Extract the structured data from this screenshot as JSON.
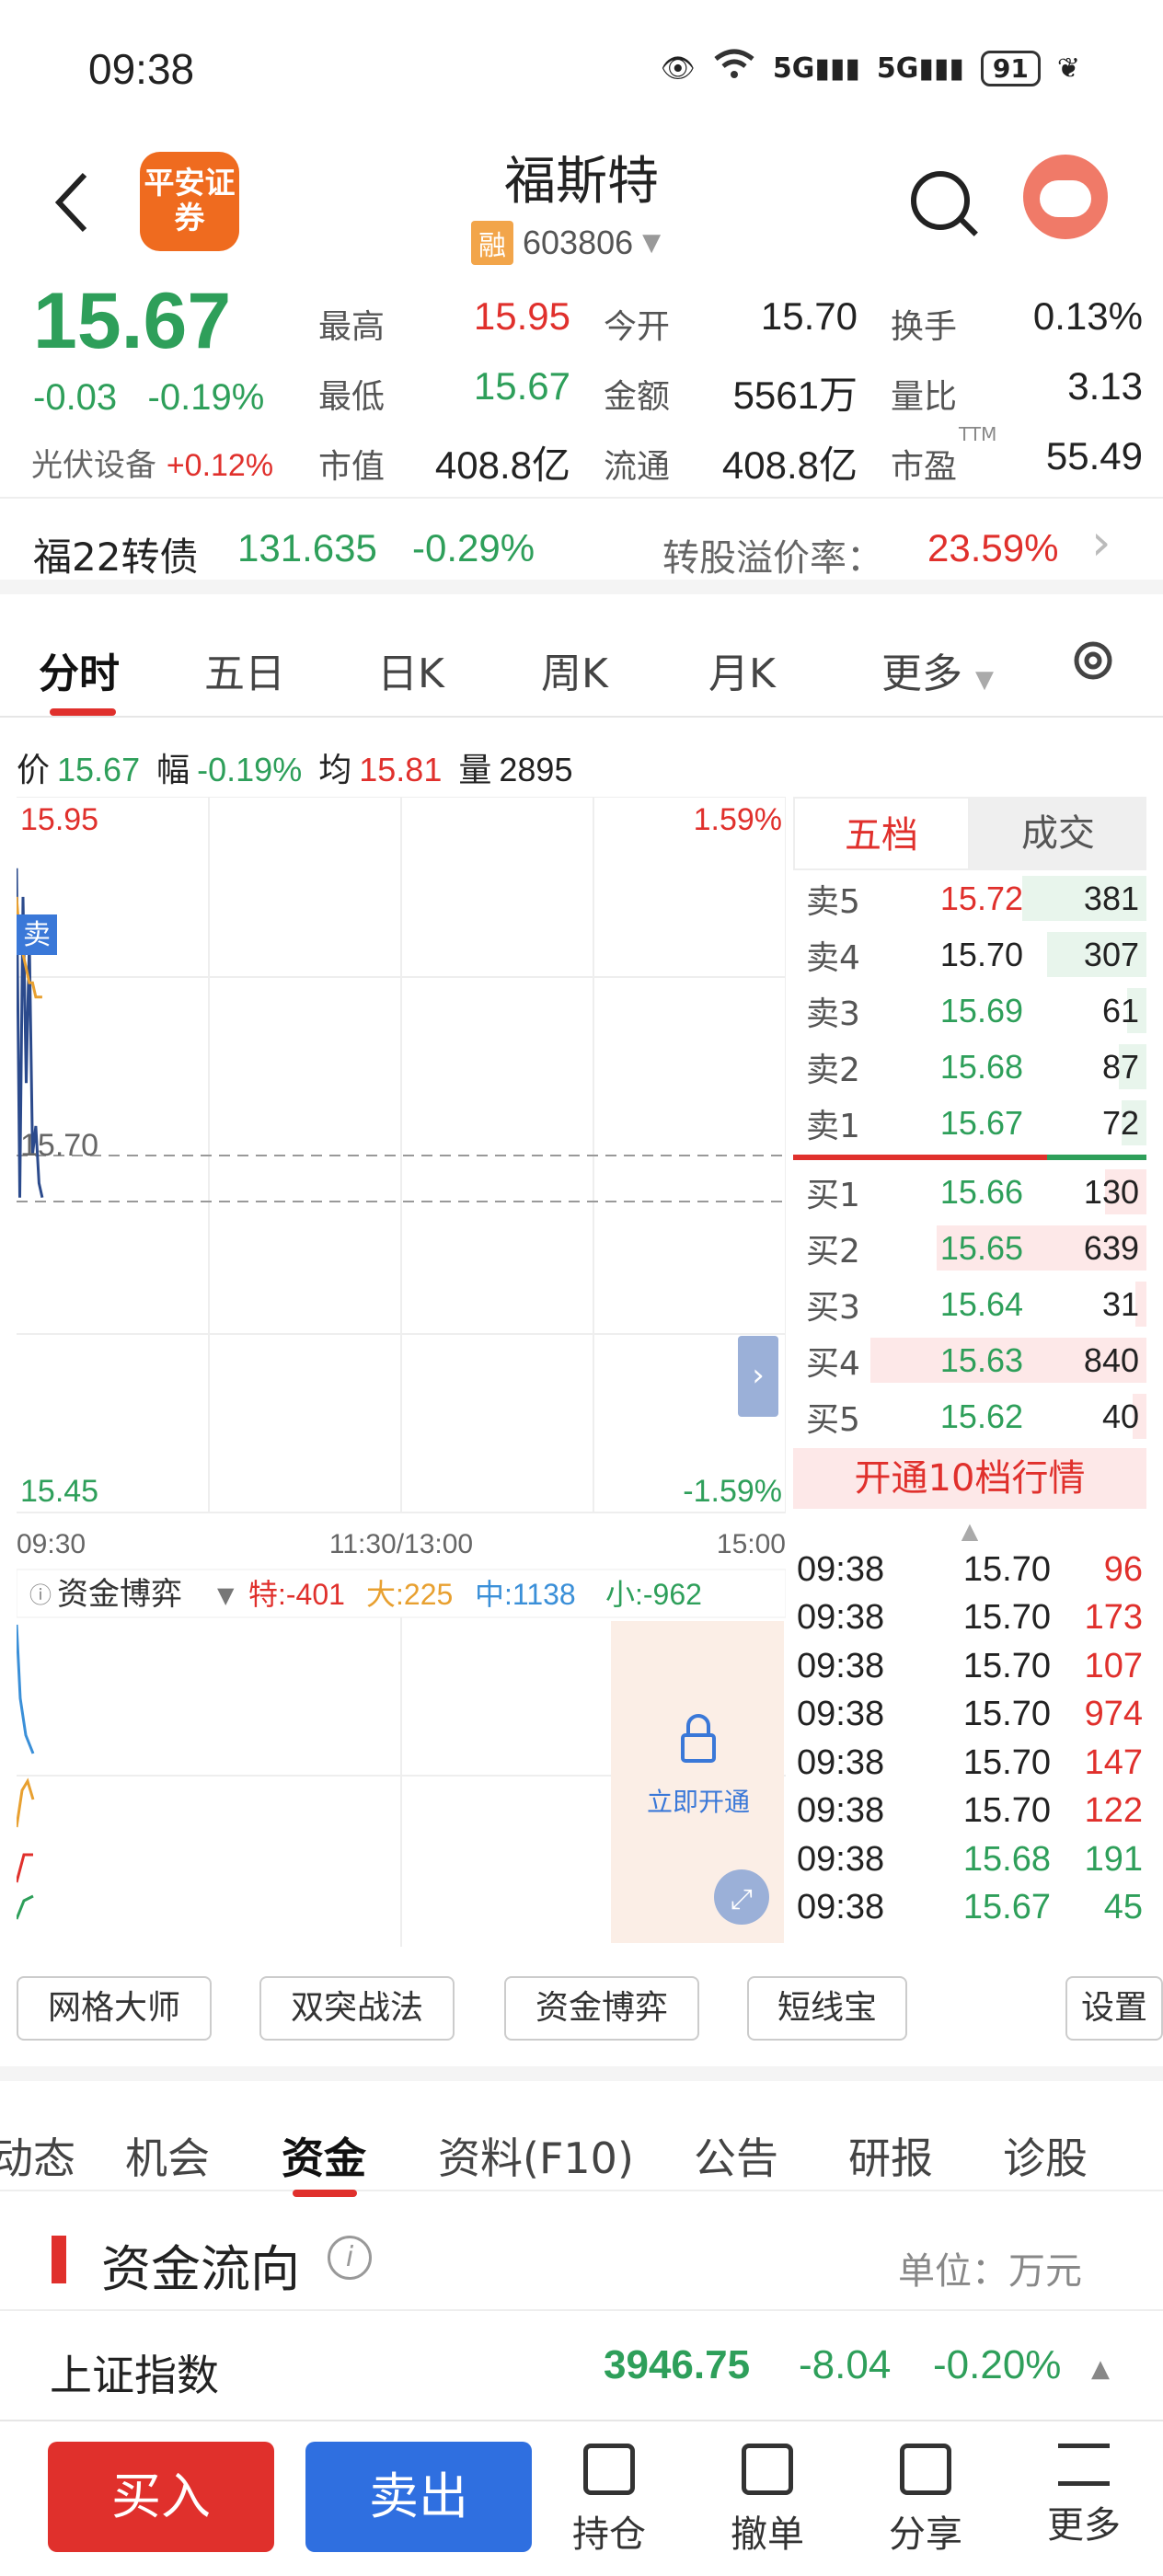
{
  "status": {
    "time": "09:38",
    "network": "5G",
    "network2": "5G",
    "battery": "91"
  },
  "header": {
    "name": "福斯特",
    "code": "603806",
    "rong": "融",
    "logo": "平安证券"
  },
  "quote": {
    "price": "15.67",
    "change": "-0.03",
    "change_pct": "-0.19%",
    "sector_name": "光伏设备",
    "sector_pct": "+0.12%",
    "high_lbl": "最高",
    "high": "15.95",
    "low_lbl": "最低",
    "low": "15.67",
    "cap_lbl": "市值",
    "cap": "408.8亿",
    "open_lbl": "今开",
    "open": "15.70",
    "amt_lbl": "金额",
    "amt": "5561万",
    "float_lbl": "流通",
    "float": "408.8亿",
    "turn_lbl": "换手",
    "turn": "0.13%",
    "vr_lbl": "量比",
    "vr": "3.13",
    "pe_lbl": "市盈",
    "pe_sup": "TTM",
    "pe": "55.49"
  },
  "bond": {
    "name": "福22转债",
    "price": "131.635",
    "pct": "-0.29%",
    "prem_lbl": "转股溢价率：",
    "prem": "23.59%"
  },
  "chart_tabs": [
    "分时",
    "五日",
    "日K",
    "周K",
    "月K",
    "更多"
  ],
  "info": {
    "price_lbl": "价",
    "price": "15.67",
    "pct_lbl": "幅",
    "pct": "-0.19%",
    "avg_lbl": "均",
    "avg": "15.81",
    "vol_lbl": "量",
    "vol": "2895"
  },
  "chart_labels": {
    "y_top": "15.95",
    "y_top_pct": "1.59%",
    "y_mid": "15.70",
    "y_bot": "15.45",
    "y_bot_pct": "-1.59%",
    "x_start": "09:30",
    "x_mid": "11:30/13:00",
    "x_end": "15:00",
    "sell_marker": "卖"
  },
  "chart_data": {
    "type": "line",
    "x": [
      "09:30",
      "09:31",
      "09:32",
      "09:33",
      "09:34",
      "09:35",
      "09:36",
      "09:37",
      "09:38"
    ],
    "series": [
      {
        "values": [
          15.9,
          15.67,
          15.88,
          15.75,
          15.85,
          15.7,
          15.72,
          15.68,
          15.67
        ]
      },
      {
        "values": [
          15.88,
          15.85,
          15.84,
          15.83,
          15.82,
          15.82,
          15.81,
          15.81,
          15.81
        ]
      }
    ],
    "ylim": [
      15.45,
      15.95
    ]
  },
  "book": {
    "tab_active": "五档",
    "tab_other": "成交",
    "asks": [
      {
        "lbl": "卖5",
        "price": "15.72",
        "vol": "381",
        "share": 0.45
      },
      {
        "lbl": "卖4",
        "price": "15.70",
        "vol": "307",
        "share": 0.36
      },
      {
        "lbl": "卖3",
        "price": "15.69",
        "vol": "61",
        "share": 0.07
      },
      {
        "lbl": "卖2",
        "price": "15.68",
        "vol": "87",
        "share": 0.1
      },
      {
        "lbl": "卖1",
        "price": "15.67",
        "vol": "72",
        "share": 0.09
      }
    ],
    "bids": [
      {
        "lbl": "买1",
        "price": "15.66",
        "vol": "130",
        "share": 0.15
      },
      {
        "lbl": "买2",
        "price": "15.65",
        "vol": "639",
        "share": 0.76
      },
      {
        "lbl": "买3",
        "price": "15.64",
        "vol": "31",
        "share": 0.04
      },
      {
        "lbl": "买4",
        "price": "15.63",
        "vol": "840",
        "share": 1.0
      },
      {
        "lbl": "买5",
        "price": "15.62",
        "vol": "40",
        "share": 0.05
      }
    ],
    "promo": "开通10档行情"
  },
  "trades": [
    {
      "time": "09:38",
      "price": "15.70",
      "vol": "96",
      "pc": "black",
      "vc": "red"
    },
    {
      "time": "09:38",
      "price": "15.70",
      "vol": "173",
      "pc": "black",
      "vc": "red"
    },
    {
      "time": "09:38",
      "price": "15.70",
      "vol": "107",
      "pc": "black",
      "vc": "red"
    },
    {
      "time": "09:38",
      "price": "15.70",
      "vol": "974",
      "pc": "black",
      "vc": "red"
    },
    {
      "time": "09:38",
      "price": "15.70",
      "vol": "147",
      "pc": "black",
      "vc": "red"
    },
    {
      "time": "09:38",
      "price": "15.70",
      "vol": "122",
      "pc": "black",
      "vc": "red"
    },
    {
      "time": "09:38",
      "price": "15.68",
      "vol": "191",
      "pc": "green",
      "vc": "green"
    },
    {
      "time": "09:38",
      "price": "15.67",
      "vol": "45",
      "pc": "green",
      "vc": "green"
    }
  ],
  "fund_game": {
    "label": "资金博弈",
    "te": "特:-401",
    "da": "大:225",
    "zhong": "中:1138",
    "xiao": "小:-962",
    "unlock": "立即开通"
  },
  "tools": [
    "网格大师",
    "双突战法",
    "资金博弈",
    "短线宝",
    "设置"
  ],
  "bottom_tabs": [
    "动态",
    "机会",
    "资金",
    "资料(F10)",
    "公告",
    "研报",
    "诊股"
  ],
  "fund_flow": {
    "title": "资金流向",
    "info": "i",
    "unit": "单位：万元"
  },
  "index_row": {
    "name": "上证指数",
    "value": "3946.75",
    "chg": "-8.04",
    "pct": "-0.20%"
  },
  "bottom_bar": {
    "buy": "买入",
    "sell": "卖出",
    "hold": "持仓",
    "cancel": "撤单",
    "share": "分享",
    "more": "更多"
  },
  "colors": {
    "red": "#e0302c",
    "green": "#2e9f5a",
    "blue": "#2f6fe0",
    "brand": "#ef6b1f"
  }
}
